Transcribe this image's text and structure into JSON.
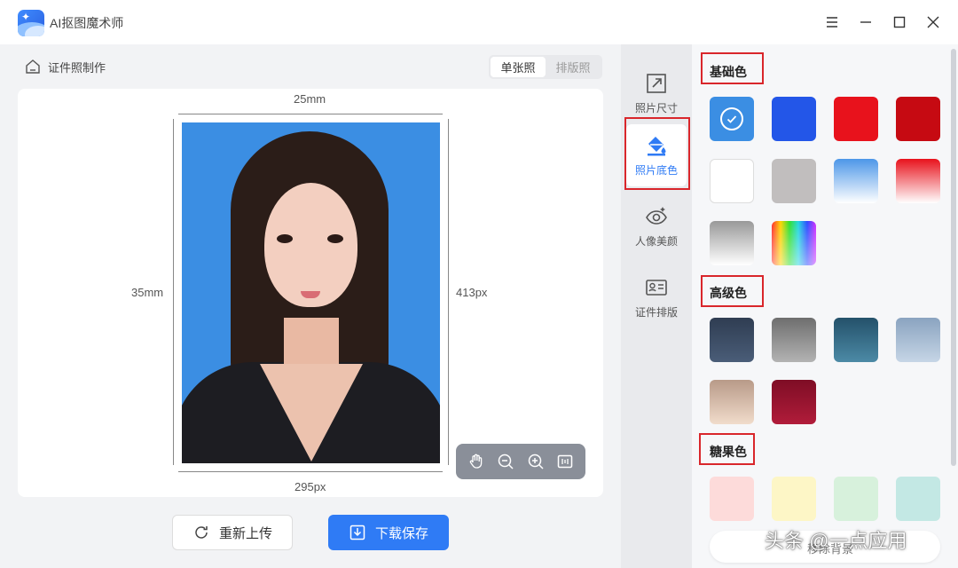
{
  "app": {
    "title": "AI抠图魔术师"
  },
  "header": {
    "section_title": "证件照制作",
    "modes": [
      {
        "label": "单张照",
        "active": true
      },
      {
        "label": "排版照",
        "active": false
      }
    ]
  },
  "dimensions": {
    "width_mm": "25mm",
    "height_mm": "35mm",
    "height_px": "413px",
    "width_px": "295px"
  },
  "photo": {
    "background_color": "#3b8ee3"
  },
  "zoom_toolbar": {
    "icons": [
      "hand-icon",
      "zoom-out-icon",
      "zoom-in-icon",
      "fit-icon"
    ]
  },
  "actions": {
    "reupload_label": "重新上传",
    "download_label": "下载保存"
  },
  "tools": [
    {
      "label": "照片尺寸",
      "icon": "resize-icon",
      "active": false
    },
    {
      "label": "照片底色",
      "icon": "paint-bucket-icon",
      "active": true
    },
    {
      "label": "人像美颜",
      "icon": "eye-sparkle-icon",
      "active": false
    },
    {
      "label": "证件排版",
      "icon": "id-card-icon",
      "active": false
    }
  ],
  "colors": {
    "basic_title": "基础色",
    "advanced_title": "高级色",
    "candy_title": "糖果色",
    "basic": [
      "#3b8ee3",
      "#2356e8",
      "#e8121c",
      "#c60a12",
      "#ffffff",
      "#c1bebe",
      "gradient-blue",
      "gradient-red",
      "gradient-gray",
      "rainbow"
    ],
    "advanced": [
      "#3a4b63",
      "gradient-darkgray",
      "gradient-teal",
      "gradient-steelblue",
      "gradient-tan",
      "gradient-burgundy"
    ],
    "candy": [
      "#fddbda",
      "#fdf6c6",
      "#d7f1dc",
      "#c3e8e4"
    ],
    "selected_index": 0
  },
  "bottom": {
    "text": "移除背景"
  },
  "watermark": {
    "text": "头条 @一点应用"
  }
}
